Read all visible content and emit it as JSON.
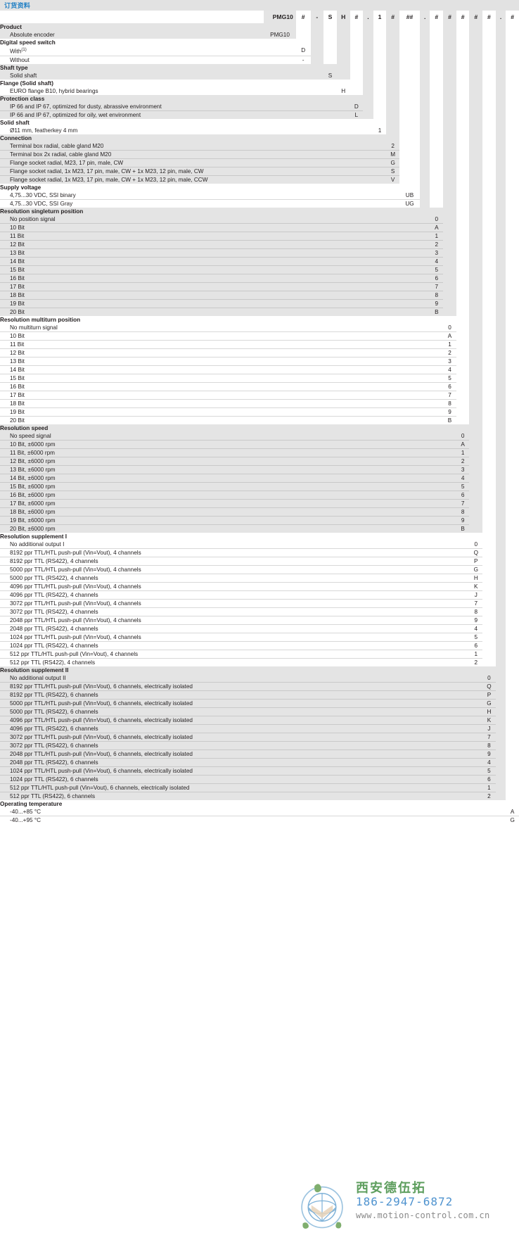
{
  "title": "订货资料",
  "colors": {
    "title_blue": "#1f7fc4",
    "band_grey": "#e2e2e2",
    "row_grey": "#e4e4e4",
    "text": "#231f20",
    "watermark_green": "#5e9e5e",
    "watermark_blue": "#4f93cf",
    "watermark_grey": "#8a8a8a"
  },
  "header_codes": [
    "PMG10",
    "#",
    "-",
    "S",
    "H",
    "#",
    ".",
    "1",
    "#",
    "##",
    ".",
    "#",
    "#",
    "#",
    "#",
    "#",
    ".",
    "#"
  ],
  "watermark": {
    "company_cn": "西安德伍拓",
    "phone": "186-2947-6872",
    "website": "www.motion-control.com.cn"
  },
  "groups": [
    {
      "name": "Product",
      "col": 0,
      "style": "grey",
      "rows": [
        {
          "label": "Absolute encoder",
          "code": "PMG10"
        }
      ]
    },
    {
      "name": "Digital speed switch",
      "col": 1,
      "style": "white",
      "rows": [
        {
          "label": "With",
          "sup": "(1)",
          "code": "D"
        },
        {
          "label": "Without",
          "code": "-"
        }
      ]
    },
    {
      "name": "Shaft type",
      "col": 3,
      "style": "grey",
      "rows": [
        {
          "label": "Solid shaft",
          "code": "S"
        }
      ]
    },
    {
      "name": "Flange (Solid shaft)",
      "col": 4,
      "style": "white",
      "rows": [
        {
          "label": "EURO flange B10, hybrid bearings",
          "code": "H"
        }
      ]
    },
    {
      "name": "Protection class",
      "col": 5,
      "style": "grey",
      "rows": [
        {
          "label": "IP 66 and IP 67, optimized for dusty, abrassive environment",
          "code": "D"
        },
        {
          "label": "IP 66 and IP 67, optimized for oily, wet environment",
          "code": "L"
        }
      ]
    },
    {
      "name": "Solid shaft",
      "col": 7,
      "style": "white",
      "rows": [
        {
          "label": "Ø11 mm, featherkey 4 mm",
          "code": "1"
        }
      ]
    },
    {
      "name": "Connection",
      "col": 8,
      "style": "grey",
      "rows": [
        {
          "label": "Terminal box radial, cable gland M20",
          "code": "2"
        },
        {
          "label": "Terminal box 2x radial, cable gland M20",
          "code": "M"
        },
        {
          "label": "Flange socket radial, M23, 17 pin, male, CW",
          "code": "G"
        },
        {
          "label": "Flange socket radial, 1x M23, 17 pin, male, CW + 1x M23, 12 pin, male, CW",
          "code": "S"
        },
        {
          "label": "Flange socket radial, 1x M23, 17 pin, male, CW + 1x M23, 12 pin, male, CCW",
          "code": "V"
        }
      ]
    },
    {
      "name": "Supply voltage",
      "col": 9,
      "style": "white",
      "rows": [
        {
          "label": "4,75...30 VDC, SSI binary",
          "code": "UB"
        },
        {
          "label": "4,75...30 VDC, SSI Gray",
          "code": "UG"
        }
      ]
    },
    {
      "name": "Resolution singleturn position",
      "col": 11,
      "style": "grey",
      "rows": [
        {
          "label": "No position signal",
          "code": "0"
        },
        {
          "label": "10 Bit",
          "code": "A"
        },
        {
          "label": "11 Bit",
          "code": "1"
        },
        {
          "label": "12 Bit",
          "code": "2"
        },
        {
          "label": "13 Bit",
          "code": "3"
        },
        {
          "label": "14 Bit",
          "code": "4"
        },
        {
          "label": "15 Bit",
          "code": "5"
        },
        {
          "label": "16 Bit",
          "code": "6"
        },
        {
          "label": "17 Bit",
          "code": "7"
        },
        {
          "label": "18 Bit",
          "code": "8"
        },
        {
          "label": "19 Bit",
          "code": "9"
        },
        {
          "label": "20 Bit",
          "code": "B"
        }
      ]
    },
    {
      "name": "Resolution multiturn position",
      "col": 12,
      "style": "white",
      "rows": [
        {
          "label": "No multiturn signal",
          "code": "0"
        },
        {
          "label": "10 Bit",
          "code": "A"
        },
        {
          "label": "11 Bit",
          "code": "1"
        },
        {
          "label": "12 Bit",
          "code": "2"
        },
        {
          "label": "13 Bit",
          "code": "3"
        },
        {
          "label": "14 Bit",
          "code": "4"
        },
        {
          "label": "15 Bit",
          "code": "5"
        },
        {
          "label": "16 Bit",
          "code": "6"
        },
        {
          "label": "17 Bit",
          "code": "7"
        },
        {
          "label": "18 Bit",
          "code": "8"
        },
        {
          "label": "19 Bit",
          "code": "9"
        },
        {
          "label": "20 Bit",
          "code": "B"
        }
      ]
    },
    {
      "name": "Resolution speed",
      "col": 13,
      "style": "grey",
      "rows": [
        {
          "label": "No speed signal",
          "code": "0"
        },
        {
          "label": "10 Bit, ±6000 rpm",
          "code": "A"
        },
        {
          "label": "11 Bit, ±6000 rpm",
          "code": "1"
        },
        {
          "label": "12 Bit, ±6000 rpm",
          "code": "2"
        },
        {
          "label": "13 Bit, ±6000 rpm",
          "code": "3"
        },
        {
          "label": "14 Bit, ±6000 rpm",
          "code": "4"
        },
        {
          "label": "15 Bit, ±6000 rpm",
          "code": "5"
        },
        {
          "label": "16 Bit, ±6000 rpm",
          "code": "6"
        },
        {
          "label": "17 Bit, ±6000 rpm",
          "code": "7"
        },
        {
          "label": "18 Bit, ±6000 rpm",
          "code": "8"
        },
        {
          "label": "19 Bit, ±6000 rpm",
          "code": "9"
        },
        {
          "label": "20 Bit, ±6000 rpm",
          "code": "B"
        }
      ]
    },
    {
      "name": "Resolution supplement I",
      "col": 14,
      "style": "white",
      "rows": [
        {
          "label": "No additional output I",
          "code": "0"
        },
        {
          "label": "8192 ppr TTL/HTL push-pull (Vin=Vout), 4 channels",
          "code": "Q"
        },
        {
          "label": "8192 ppr TTL (RS422), 4 channels",
          "code": "P"
        },
        {
          "label": "5000 ppr TTL/HTL push-pull (Vin=Vout), 4 channels",
          "code": "G"
        },
        {
          "label": "5000 ppr TTL (RS422), 4 channels",
          "code": "H"
        },
        {
          "label": "4096 ppr TTL/HTL push-pull (Vin=Vout), 4 channels",
          "code": "K"
        },
        {
          "label": "4096 ppr TTL (RS422), 4 channels",
          "code": "J"
        },
        {
          "label": "3072 ppr TTL/HTL push-pull (Vin=Vout), 4 channels",
          "code": "7"
        },
        {
          "label": "3072 ppr TTL (RS422), 4 channels",
          "code": "8"
        },
        {
          "label": "2048 ppr TTL/HTL push-pull (Vin=Vout), 4 channels",
          "code": "9"
        },
        {
          "label": "2048 ppr TTL (RS422), 4 channels",
          "code": "4"
        },
        {
          "label": "1024 ppr TTL/HTL push-pull (Vin=Vout), 4 channels",
          "code": "5"
        },
        {
          "label": "1024 ppr TTL (RS422), 4 channels",
          "code": "6"
        },
        {
          "label": "512 ppr TTL/HTL push-pull (Vin=Vout), 4 channels",
          "code": "1"
        },
        {
          "label": "512 ppr TTL (RS422), 4 channels",
          "code": "2"
        }
      ]
    },
    {
      "name": "Resolution supplement II",
      "col": 15,
      "style": "grey",
      "rows": [
        {
          "label": "No additional output II",
          "code": "0"
        },
        {
          "label": "8192 ppr TTL/HTL push-pull (Vin=Vout), 6 channels, electrically isolated",
          "code": "Q"
        },
        {
          "label": "8192 ppr TTL (RS422), 6 channels",
          "code": "P"
        },
        {
          "label": "5000 ppr TTL/HTL push-pull (Vin=Vout), 6 channels, electrically isolated",
          "code": "G"
        },
        {
          "label": "5000 ppr TTL (RS422), 6 channels",
          "code": "H"
        },
        {
          "label": "4096 ppr TTL/HTL push-pull (Vin=Vout), 6 channels, electrically isolated",
          "code": "K"
        },
        {
          "label": "4096 ppr TTL (RS422), 6 channels",
          "code": "J"
        },
        {
          "label": "3072 ppr TTL/HTL push-pull (Vin=Vout), 6 channels, electrically isolated",
          "code": "7"
        },
        {
          "label": "3072 ppr TTL (RS422), 6 channels",
          "code": "8"
        },
        {
          "label": "2048 ppr TTL/HTL push-pull (Vin=Vout), 6 channels, electrically isolated",
          "code": "9"
        },
        {
          "label": "2048 ppr TTL (RS422), 6 channels",
          "code": "4"
        },
        {
          "label": "1024 ppr TTL/HTL push-pull (Vin=Vout), 6 channels, electrically isolated",
          "code": "5"
        },
        {
          "label": "1024 ppr TTL (RS422), 6 channels",
          "code": "6"
        },
        {
          "label": "512 ppr TTL/HTL push-pull (Vin=Vout), 6 channels, electrically isolated",
          "code": "1"
        },
        {
          "label": "512 ppr TTL (RS422), 6 channels",
          "code": "2"
        }
      ]
    },
    {
      "name": "Operating temperature",
      "col": 17,
      "style": "white",
      "rows": [
        {
          "label": "-40...+85 °C",
          "code": "A"
        },
        {
          "label": "-40...+95 °C",
          "code": "G"
        }
      ]
    }
  ]
}
